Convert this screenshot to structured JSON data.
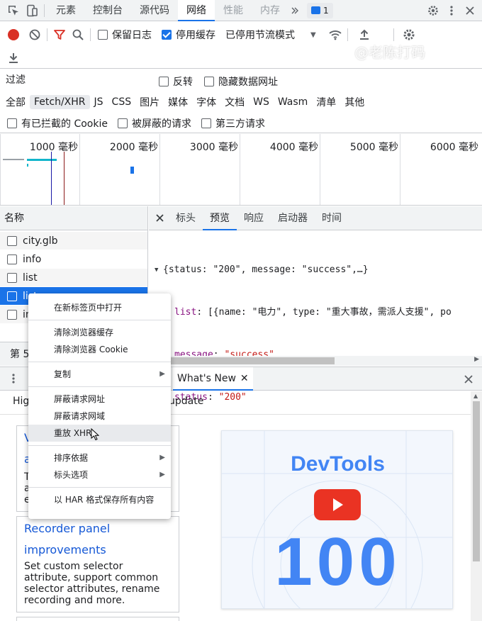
{
  "top_tabs": [
    "元素",
    "控制台",
    "源代码",
    "网络",
    "性能",
    "内存"
  ],
  "active_top_tab": "网络",
  "issues_count": "1",
  "watermark": "@老陈打码",
  "toolbar": {
    "preserve_log": "保留日志",
    "disable_cache": "停用缓存",
    "throttle": "已停用节流模式"
  },
  "filter": {
    "placeholder": "过滤",
    "invert": "反转",
    "hide_data_urls": "隐藏数据网址"
  },
  "type_filters": [
    "全部",
    "Fetch/XHR",
    "JS",
    "CSS",
    "图片",
    "媒体",
    "字体",
    "文档",
    "WS",
    "Wasm",
    "清单",
    "其他"
  ],
  "active_type_filter": "Fetch/XHR",
  "block_filters": {
    "blocked_cookies": "有已拦截的 Cookie",
    "blocked_requests": "被屏蔽的请求",
    "third_party": "第三方请求"
  },
  "timeline_ticks": [
    "1000 毫秒",
    "2000 毫秒",
    "3000 毫秒",
    "4000 毫秒",
    "5000 毫秒",
    "6000 毫秒"
  ],
  "requests": {
    "header": "名称",
    "rows": [
      "city.glb",
      "info",
      "list",
      "list",
      "in"
    ],
    "footer": "第 5"
  },
  "detail_tabs": [
    "标头",
    "预览",
    "响应",
    "启动器",
    "时间"
  ],
  "active_detail_tab": "预览",
  "preview": {
    "line1": "{status: \"200\", message: \"success\",…}",
    "line2_key": "list",
    "line2_value": "[{name: \"电力\", type: \"重大事故，需派人支援\", po",
    "line3_key": "message",
    "line3_value": "\"success\"",
    "line4_key": "status",
    "line4_value": "\"200\""
  },
  "context_menu": {
    "open_new_tab": "在新标签页中打开",
    "clear_cache": "清除浏览器缓存",
    "clear_cookies": "清除浏览器 Cookie",
    "copy": "复制",
    "block_url": "屏蔽请求网址",
    "block_domain": "屏蔽请求网域",
    "replay_xhr": "重放 XHR",
    "sort_by": "排序依据",
    "header_options": "标头选项",
    "save_har": "以 HAR 格式保存所有内容"
  },
  "drawer": {
    "tab_label": "What's New",
    "highlights_partial": "Hig",
    "update_partial": "update"
  },
  "whats_new": {
    "card1_title_partial_a": "V",
    "card1_title_partial_b": "a",
    "card1_body_partial": [
      "T",
      "a",
      "e"
    ],
    "card2_title_line1": "Recorder panel",
    "card2_title_line2": "improvements",
    "card2_body": [
      "Set custom selector",
      "attribute, support common",
      "selector attributes, rename",
      "recording and more."
    ],
    "promo_title": "DevTools",
    "promo_version": "100"
  },
  "colors": {
    "accent": "#1a73e8",
    "record_red": "#d93025",
    "link_blue": "#1558d6",
    "promo_blue": "#4285f4"
  }
}
